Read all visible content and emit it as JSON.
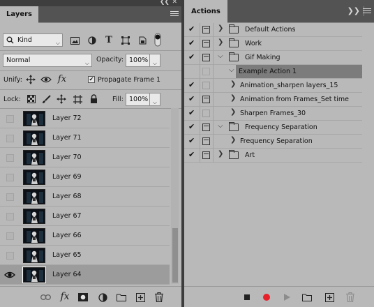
{
  "layers_panel": {
    "tab_label": "Layers",
    "filter": {
      "kind_label": "Kind"
    },
    "blend_mode": "Normal",
    "opacity_label": "Opacity:",
    "opacity_value": "100%",
    "unify_label": "Unify:",
    "propagate_label": "Propagate Frame 1",
    "lock_label": "Lock:",
    "fill_label": "Fill:",
    "fill_value": "100%",
    "layers": [
      {
        "name": "Layer 72",
        "visible": false,
        "selected": false
      },
      {
        "name": "Layer 71",
        "visible": false,
        "selected": false
      },
      {
        "name": "Layer 70",
        "visible": false,
        "selected": false
      },
      {
        "name": "Layer 69",
        "visible": false,
        "selected": false
      },
      {
        "name": "Layer 68",
        "visible": false,
        "selected": false
      },
      {
        "name": "Layer 67",
        "visible": false,
        "selected": false
      },
      {
        "name": "Layer 66",
        "visible": false,
        "selected": false
      },
      {
        "name": "Layer 65",
        "visible": false,
        "selected": false
      },
      {
        "name": "Layer 64",
        "visible": true,
        "selected": true
      }
    ],
    "footer_icons": [
      "link-icon",
      "fx-icon",
      "mask-icon",
      "adjustment-icon",
      "folder-icon",
      "new-layer-icon",
      "trash-icon"
    ]
  },
  "actions_panel": {
    "tab_label": "Actions",
    "actions": [
      {
        "label": "Default Actions",
        "checked": true,
        "dialog": true,
        "type": "set",
        "expanded": false,
        "indent": 0
      },
      {
        "label": "Work",
        "checked": true,
        "dialog": true,
        "type": "set",
        "expanded": false,
        "indent": 0
      },
      {
        "label": "Gif Making",
        "checked": true,
        "dialog": true,
        "type": "set",
        "expanded": true,
        "indent": 0
      },
      {
        "label": "Example Action 1",
        "checked": false,
        "dialog": false,
        "type": "action",
        "expanded": true,
        "indent": 1,
        "selected": true
      },
      {
        "label": "Animation_sharpen layers_15",
        "checked": true,
        "dialog": false,
        "type": "action",
        "expanded": false,
        "indent": 1
      },
      {
        "label": "Animation from Frames_Set time",
        "checked": true,
        "dialog": true,
        "type": "action",
        "expanded": false,
        "indent": 1
      },
      {
        "label": "Sharpen Frames_30",
        "checked": true,
        "dialog": false,
        "type": "action",
        "expanded": false,
        "indent": 1
      },
      {
        "label": "Frequency Separation",
        "checked": true,
        "dialog": true,
        "type": "set",
        "expanded": true,
        "indent": 0
      },
      {
        "label": "Frequency Separation",
        "checked": true,
        "dialog": true,
        "type": "action",
        "expanded": false,
        "indent": 1
      },
      {
        "label": "Art",
        "checked": true,
        "dialog": true,
        "type": "set",
        "expanded": false,
        "indent": 0
      }
    ],
    "footer_icons": [
      "stop-icon",
      "record-icon",
      "play-icon",
      "new-set-icon",
      "new-action-icon",
      "trash-icon"
    ],
    "record_color": "#e8202a"
  }
}
